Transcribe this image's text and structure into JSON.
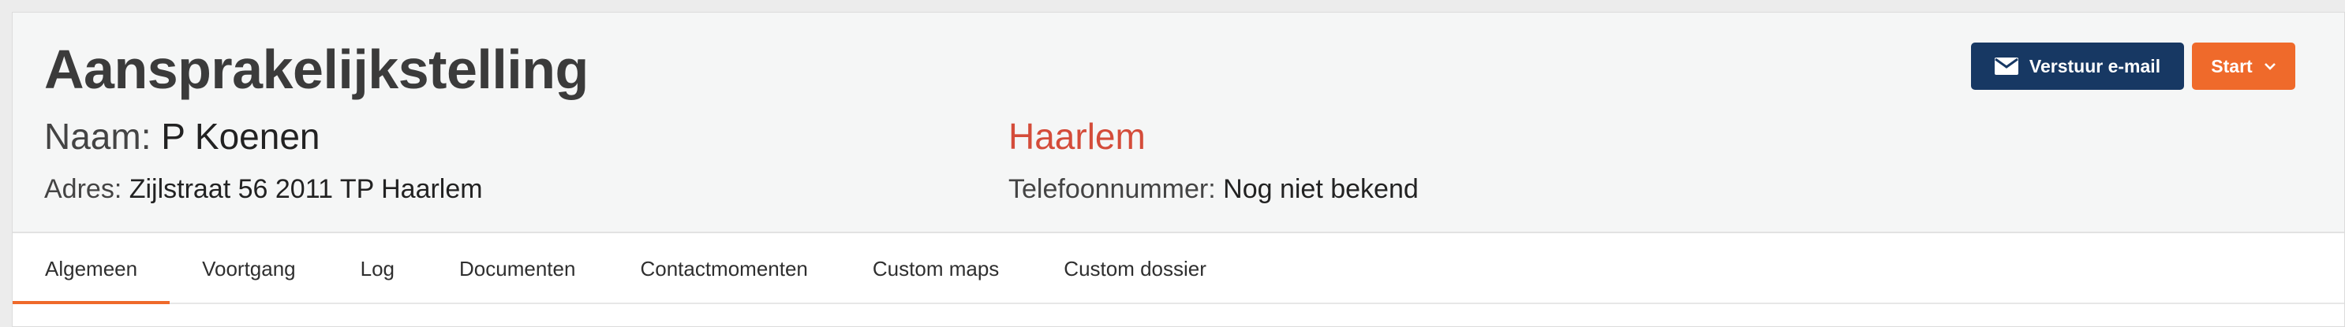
{
  "header": {
    "title": "Aansprakelijkstelling",
    "name_label": "Naam:",
    "name_value": "P Koenen",
    "address_label": "Adres:",
    "address_value": "Zijlstraat 56 2011 TP Haarlem",
    "city": "Haarlem",
    "phone_label": "Telefoonnummer:",
    "phone_value": "Nog niet bekend"
  },
  "actions": {
    "email_label": "Verstuur e-mail",
    "start_label": "Start",
    "email_icon": "envelope-icon",
    "start_icon": "chevron-down-icon"
  },
  "tabs": [
    {
      "label": "Algemeen",
      "active": true
    },
    {
      "label": "Voortgang",
      "active": false
    },
    {
      "label": "Log",
      "active": false
    },
    {
      "label": "Documenten",
      "active": false
    },
    {
      "label": "Contactmomenten",
      "active": false
    },
    {
      "label": "Custom maps",
      "active": false
    },
    {
      "label": "Custom dossier",
      "active": false
    }
  ],
  "colors": {
    "accent": "#ef6a2b",
    "primary": "#173863",
    "city": "#d44c3a"
  }
}
